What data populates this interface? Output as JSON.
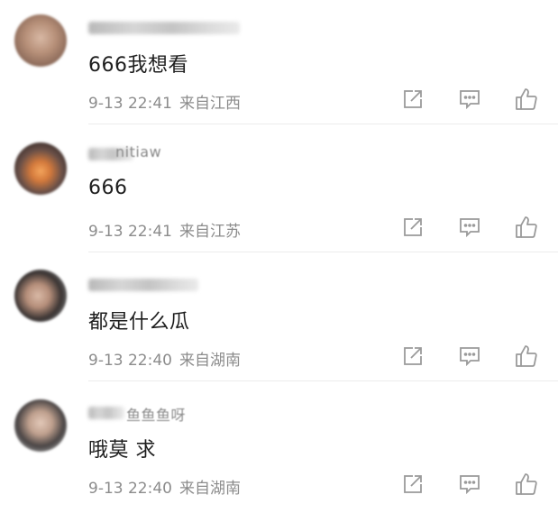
{
  "comments": [
    {
      "username_visible_tail": "",
      "text": "666我想看",
      "time": "9-13 22:41",
      "location": "来自江西"
    },
    {
      "username_visible_tail": "nitiaw",
      "text": "666",
      "time": "9-13 22:41",
      "location": "来自江苏"
    },
    {
      "username_visible_tail": "",
      "text": "都是什么瓜",
      "time": "9-13 22:40",
      "location": "来自湖南"
    },
    {
      "username_visible_tail": "鱼鱼鱼呀",
      "text": "哦莫 求",
      "time": "9-13 22:40",
      "location": "来自湖南"
    }
  ],
  "icons": {
    "share": "share-icon",
    "reply": "comment-icon",
    "like": "thumbs-up-icon"
  },
  "colors": {
    "meta_text": "#8c8c8c",
    "icon_stroke": "#9a9a9a"
  }
}
